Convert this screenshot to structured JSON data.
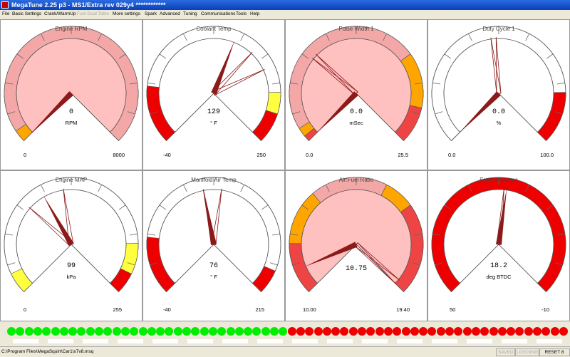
{
  "window": {
    "title": "MegaTune 2.25 p3 - MS1/Extra rev 029y4 ************"
  },
  "menu": [
    {
      "label": "File",
      "enabled": true
    },
    {
      "label": "Basic Settings",
      "enabled": true
    },
    {
      "label": "Crank/WarmUp",
      "enabled": true
    },
    {
      "label": "Fuel Dual Table",
      "enabled": false
    },
    {
      "label": "More settings",
      "enabled": true
    },
    {
      "label": "Spark",
      "enabled": true
    },
    {
      "label": "Advanced",
      "enabled": true
    },
    {
      "label": "Tuning",
      "enabled": true
    },
    {
      "label": "Communications",
      "enabled": true
    },
    {
      "label": "Tools",
      "enabled": true
    },
    {
      "label": "Help",
      "enabled": true
    }
  ],
  "gauges": [
    {
      "title": "Engine RPM",
      "value": "0",
      "unit": "RPM",
      "min": "0",
      "max": "8000",
      "bg": "#ffc0c0",
      "needle": 0,
      "trail": [
        0
      ],
      "zones": [
        [
          0,
          0.04,
          "#ffa500"
        ],
        [
          0.04,
          1,
          "#f4a7a7"
        ]
      ]
    },
    {
      "title": "Coolant Temp",
      "value": "129",
      "unit": "° F",
      "min": "-40",
      "max": "250",
      "bg": "#ffffff",
      "needle": 0.58,
      "trail": [
        0.66,
        0.74
      ],
      "zones": [
        [
          0,
          0.19,
          "#ee0000"
        ],
        [
          0.83,
          0.9,
          "#ffff40"
        ],
        [
          0.9,
          1,
          "#ee0000"
        ]
      ]
    },
    {
      "title": "Pulse Width 1",
      "value": "0.0",
      "unit": "mSec",
      "min": "0.0",
      "max": "25.5",
      "bg": "#ffc0c0",
      "needle": 0,
      "trail": [
        0.33,
        0.31
      ],
      "zones": [
        [
          0,
          0.02,
          "#ee4444"
        ],
        [
          0.02,
          0.05,
          "#ffa500"
        ],
        [
          0.05,
          0.7,
          "#f4a7a7"
        ],
        [
          0.7,
          0.88,
          "#ffa500"
        ],
        [
          0.88,
          1,
          "#ee4444"
        ]
      ]
    },
    {
      "title": "Duty Cycle 1",
      "value": "0.0",
      "unit": "%",
      "min": "0.0",
      "max": "100.0",
      "bg": "#ffffff",
      "needle": 0,
      "trail": [
        0.47,
        0.49
      ],
      "zones": [
        [
          0.83,
          1,
          "#ee0000"
        ]
      ]
    },
    {
      "title": "Engine MAP",
      "value": "99",
      "unit": "kPa",
      "min": "0",
      "max": "255",
      "bg": "#ffffff",
      "needle": 0.39,
      "trail": [
        0.32,
        0.47
      ],
      "zones": [
        [
          0,
          0.07,
          "#ffff40"
        ],
        [
          0.83,
          0.93,
          "#ffff40"
        ],
        [
          0.93,
          1,
          "#ee0000"
        ]
      ]
    },
    {
      "title": "Manifold Air Temp",
      "value": "76",
      "unit": "° F",
      "min": "-40",
      "max": "215",
      "bg": "#ffffff",
      "needle": 0.46,
      "trail": [
        0.46,
        0.53
      ],
      "zones": [
        [
          0,
          0.19,
          "#ee0000"
        ],
        [
          0.92,
          1,
          "#ee0000"
        ]
      ]
    },
    {
      "title": "Air:Fuel Ratio",
      "value": "10.75",
      "unit": "",
      "min": "10.00",
      "max": "19.40",
      "bg": "#ffc0c0",
      "needle": 0.08,
      "trail": [
        0.98,
        1
      ],
      "zones": [
        [
          0,
          0.17,
          "#ee4444"
        ],
        [
          0.17,
          0.35,
          "#ffa500"
        ],
        [
          0.35,
          0.6,
          "#f4a7a7"
        ],
        [
          0.6,
          0.7,
          "#ffa500"
        ],
        [
          0.7,
          1,
          "#ee4444"
        ]
      ]
    },
    {
      "title": "Spark Advance",
      "value": "18.2",
      "unit": "deg BTDC",
      "min": "50",
      "max": "-10",
      "bg": "#ffffff",
      "needle": 0.53,
      "trail": [
        0.52
      ],
      "zones": [
        [
          0,
          1,
          "#ee0000"
        ]
      ]
    }
  ],
  "leds": {
    "green_count": 32,
    "red_count": 32,
    "green": "#00ee00",
    "red": "#ee0000",
    "slot_count": 16
  },
  "status": {
    "path": "C:\\Program Files\\MegaSquirt\\Car1\\x7v8.msq",
    "saved": "SAVED",
    "logging": "LOGGING",
    "reset": "RESET 8"
  }
}
